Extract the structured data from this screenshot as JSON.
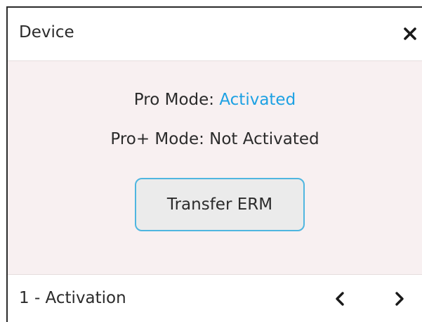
{
  "header": {
    "title": "Device",
    "close_icon": "close-icon"
  },
  "status": {
    "pro_label": "Pro Mode: ",
    "pro_value": "Activated",
    "pro_plus_text": "Pro+ Mode: Not Activated"
  },
  "actions": {
    "transfer_label": "Transfer ERM"
  },
  "footer": {
    "step_label": "1 - Activation",
    "prev_icon": "chevron-left-icon",
    "next_icon": "chevron-right-icon"
  },
  "colors": {
    "accent": "#1da1e3",
    "body_background": "#f8f0f1",
    "button_border": "#4fb6e0",
    "button_background": "#ebebeb",
    "text": "#2b2b2b"
  }
}
